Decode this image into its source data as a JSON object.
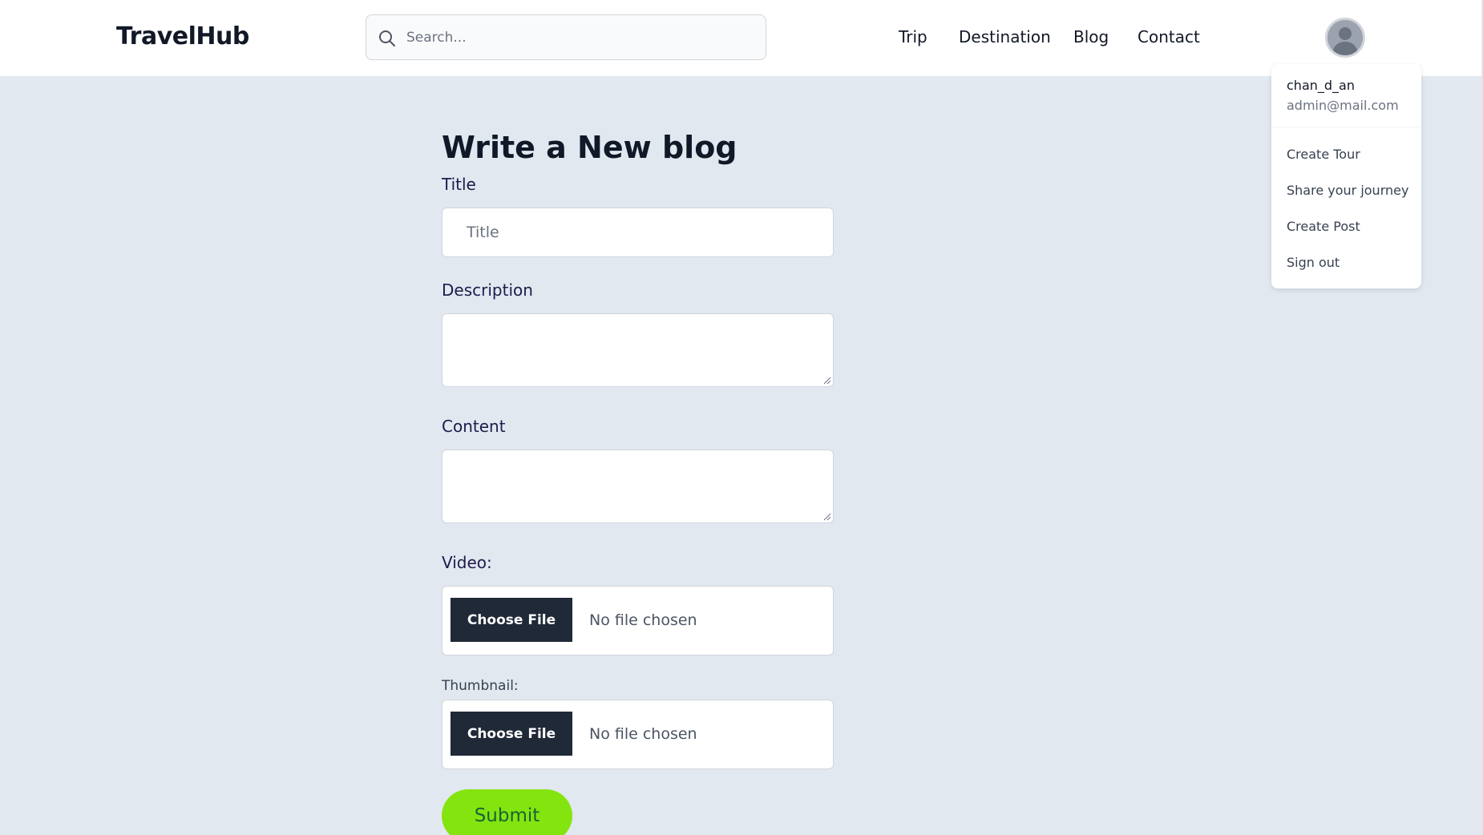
{
  "header": {
    "logo": "TravelHub",
    "search_placeholder": "Search...",
    "nav": [
      "Trip",
      "Destination",
      "Blog",
      "Contact"
    ]
  },
  "user_menu": {
    "username": "chan_d_an",
    "email": "admin@mail.com",
    "items": [
      "Create Tour",
      "Share your journey",
      "Create Post",
      "Sign out"
    ]
  },
  "form": {
    "heading": "Write a New blog",
    "title_label": "Title",
    "title_placeholder": "Title",
    "description_label": "Description",
    "content_label": "Content",
    "video_label": "Video:",
    "thumbnail_label": "Thumbnail:",
    "choose_file": "Choose File",
    "no_file": "No file chosen",
    "submit": "Submit"
  },
  "colors": {
    "page_bg": "#e2e8f0",
    "file_button": "#1f2937",
    "submit_button": "#84e40f"
  }
}
